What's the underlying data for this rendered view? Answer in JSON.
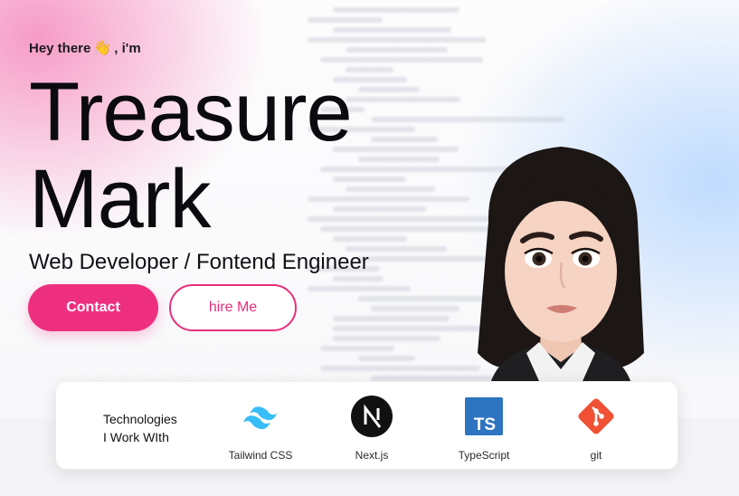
{
  "hero": {
    "greeting": "Hey there",
    "greeting_emoji": "👋",
    "greeting_suffix": ", i'm",
    "name_line1": "Treasure",
    "name_line2": "Mark",
    "role": "Web Developer / Fontend Engineer"
  },
  "actions": {
    "contact_label": "Contact",
    "hire_label": "hire Me"
  },
  "technologies": {
    "title_line1": "Technologies",
    "title_line2": "I Work WIth",
    "items": [
      {
        "label": "Tailwind CSS",
        "icon": "tailwind-icon",
        "color": "#38bdf8"
      },
      {
        "label": "Next.js",
        "icon": "nextjs-icon",
        "color": "#111111"
      },
      {
        "label": "TypeScript",
        "icon": "typescript-icon",
        "color": "#2f74c0"
      },
      {
        "label": "git",
        "icon": "git-icon",
        "color": "#f05033"
      }
    ]
  },
  "colors": {
    "accent": "#ee2f80",
    "pink_glow": "#f696c3",
    "blue_glow": "#b5d6ff"
  }
}
